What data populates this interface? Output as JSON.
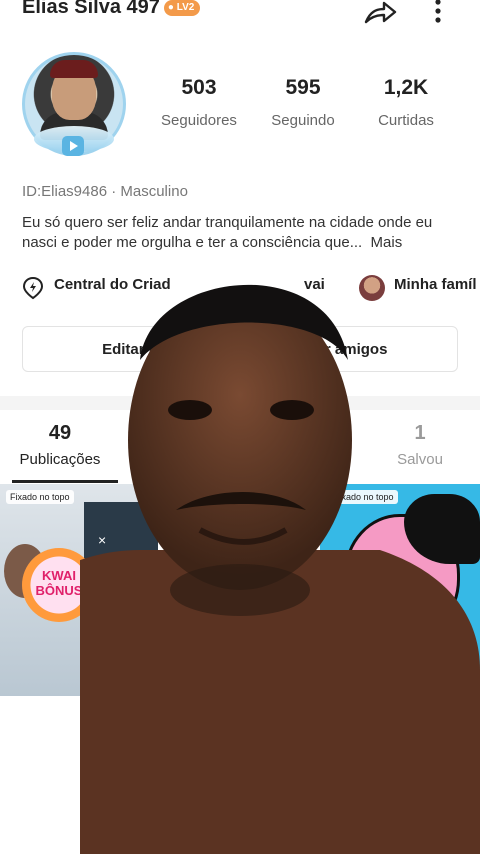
{
  "profile": {
    "name": "Elias Silva 497",
    "level": "LV2",
    "id_gender": "ID:Elias9486 · Masculino",
    "bio": "Eu só quero ser feliz andar tranquilamente na cidade onde eu nasci e poder me orgulha e ter a consciência que...",
    "bio_more": "Mais"
  },
  "stats": [
    {
      "value": "503",
      "label": "Seguidores"
    },
    {
      "value": "595",
      "label": "Seguindo"
    },
    {
      "value": "1,2K",
      "label": "Curtidas"
    }
  ],
  "chips": {
    "creator_center": "Central do Criad",
    "kwai_partial": "vai",
    "family": "Minha famíl"
  },
  "buttons": {
    "edit": "Editar p",
    "invite": "ar amigos"
  },
  "tabs": [
    {
      "count": "49",
      "label": "Publicações"
    },
    {
      "count": "1",
      "label": "Salvou"
    }
  ],
  "grid": {
    "pinned_label": "Fixado no topo",
    "bonus_line1": "KWAI",
    "bonus_line2": "BÔNUS",
    "close_glyph": "×"
  },
  "icons": [
    "share-icon",
    "more-options-icon",
    "location-pin-icon"
  ],
  "colors": {
    "level_badge": "#f39a4a",
    "avatar_ring": "#9fd3ee",
    "comic_background": "#36b9e6"
  }
}
